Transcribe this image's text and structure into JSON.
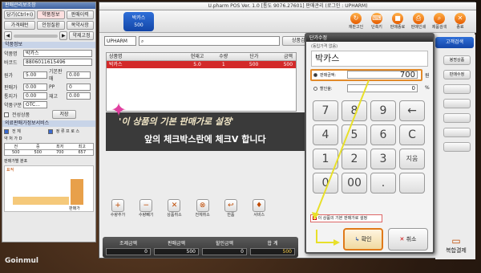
{
  "watermark": "Goinmul",
  "left_panel": {
    "title": "판매관리보조창",
    "toolbar": [
      "당기(Ctrl+I)",
      "약품정보",
      "판매이력"
    ],
    "toolbar2": [
      "가격패턴",
      "안정질환",
      "복약사항"
    ],
    "toolbar3": "약제고정",
    "info_title": "약품정보",
    "fields": [
      {
        "label": "약품명",
        "value": "박카스"
      },
      {
        "label": "바코드",
        "value": "8806011615496"
      },
      {
        "label": "원가",
        "value": "5.00",
        "label2": "기본판매",
        "value2": "0.00"
      },
      {
        "label": "판매가",
        "value": "0.00",
        "label2": "PP",
        "value2": "0"
      },
      {
        "label": "통지가",
        "value": "0.00",
        "label2": "재고",
        "value2": "0.00"
      },
      {
        "label": "약품구분",
        "value": "OTC...",
        "label2": "",
        "value2": ""
      }
    ],
    "btn_safe": "전성상품",
    "btn_save": "저장",
    "service_title": "의료판매가정보서비스",
    "chk_a": "전 체",
    "chk_b": "정 류 프 로 스",
    "chk_c": "약 처 가 D",
    "svc_cols": [
      "전",
      "중",
      "최저",
      "최고"
    ],
    "svc_vals": [
      "500",
      "500",
      "700",
      "657"
    ],
    "graph_title": "판매가별 분포",
    "graph_sub": "표적",
    "graph_label": "판매가"
  },
  "window": {
    "title": "U.pharm POS Ver. 1.0 [통도 9076.27601] 판매관리 (로그인 : UPHARM)",
    "tab_label": "박카스",
    "tab_value": "500",
    "toolbar_icons": [
      {
        "label": "재판고인",
        "icon": "reload-icon"
      },
      {
        "label": "단축키",
        "icon": "key-icon"
      },
      {
        "label": "판매종료",
        "icon": "stop-icon"
      },
      {
        "label": "판매인쇄",
        "icon": "print-icon"
      },
      {
        "label": "제품검색",
        "icon": "search-icon"
      },
      {
        "label": "종료",
        "icon": "close-icon"
      }
    ],
    "search_mode": "UPHARM",
    "search_placeholder": "",
    "search_button": "상품검색",
    "customer_button": "고객검색",
    "product_columns": [
      "상품명",
      "현재고",
      "수량",
      "단가",
      "금액"
    ],
    "product_rows": [
      {
        "name": "박카스",
        "stock": "5.0",
        "qty": "1",
        "price": "500",
        "amount": "500"
      }
    ],
    "annotation_line1": "'이 상품의 기본 판매가로 설정'",
    "annotation_line2": "앞의 체크박스란에 체크V 합니다",
    "function_buttons": [
      {
        "label": "수량추가",
        "icon": "+"
      },
      {
        "label": "수량빼기",
        "icon": "−"
      },
      {
        "label": "상품취소",
        "icon": "✕"
      },
      {
        "label": "전체취소",
        "icon": "⊗"
      },
      {
        "label": "반품",
        "icon": "↩"
      },
      {
        "label": "서비스",
        "icon": "♦"
      }
    ],
    "totals": [
      {
        "label": "조제금액",
        "value": "0"
      },
      {
        "label": "판매금액",
        "value": "500"
      },
      {
        "label": "할인금액",
        "value": "0"
      },
      {
        "label": "합 계",
        "value": "500"
      }
    ],
    "right_buttons": [
      "봉명상품",
      "판매수정",
      "",
      "",
      "",
      "",
      ""
    ],
    "complex_payment": "복합결제"
  },
  "dialog": {
    "title": "단가수정",
    "subtitle": "(동입가격 없음)",
    "product_name": "박카스",
    "price_label": "판매금액:",
    "price_value": "700",
    "price_unit": "원",
    "discount_label": "할인율:",
    "discount_value": "0",
    "discount_unit": "%",
    "keys": [
      "7",
      "8",
      "9",
      "←",
      "4",
      "5",
      "6",
      "C",
      "1",
      "2",
      "3",
      "지움",
      "0",
      "00",
      ".",
      ""
    ],
    "set_default_label": "이 상품의 기본 판매가로 설정",
    "ok_label": "확인",
    "cancel_label": "취소"
  },
  "colors": {
    "accent_red": "#d32a2a",
    "accent_orange": "#e07a1a",
    "tab_blue": "#1346a8"
  }
}
